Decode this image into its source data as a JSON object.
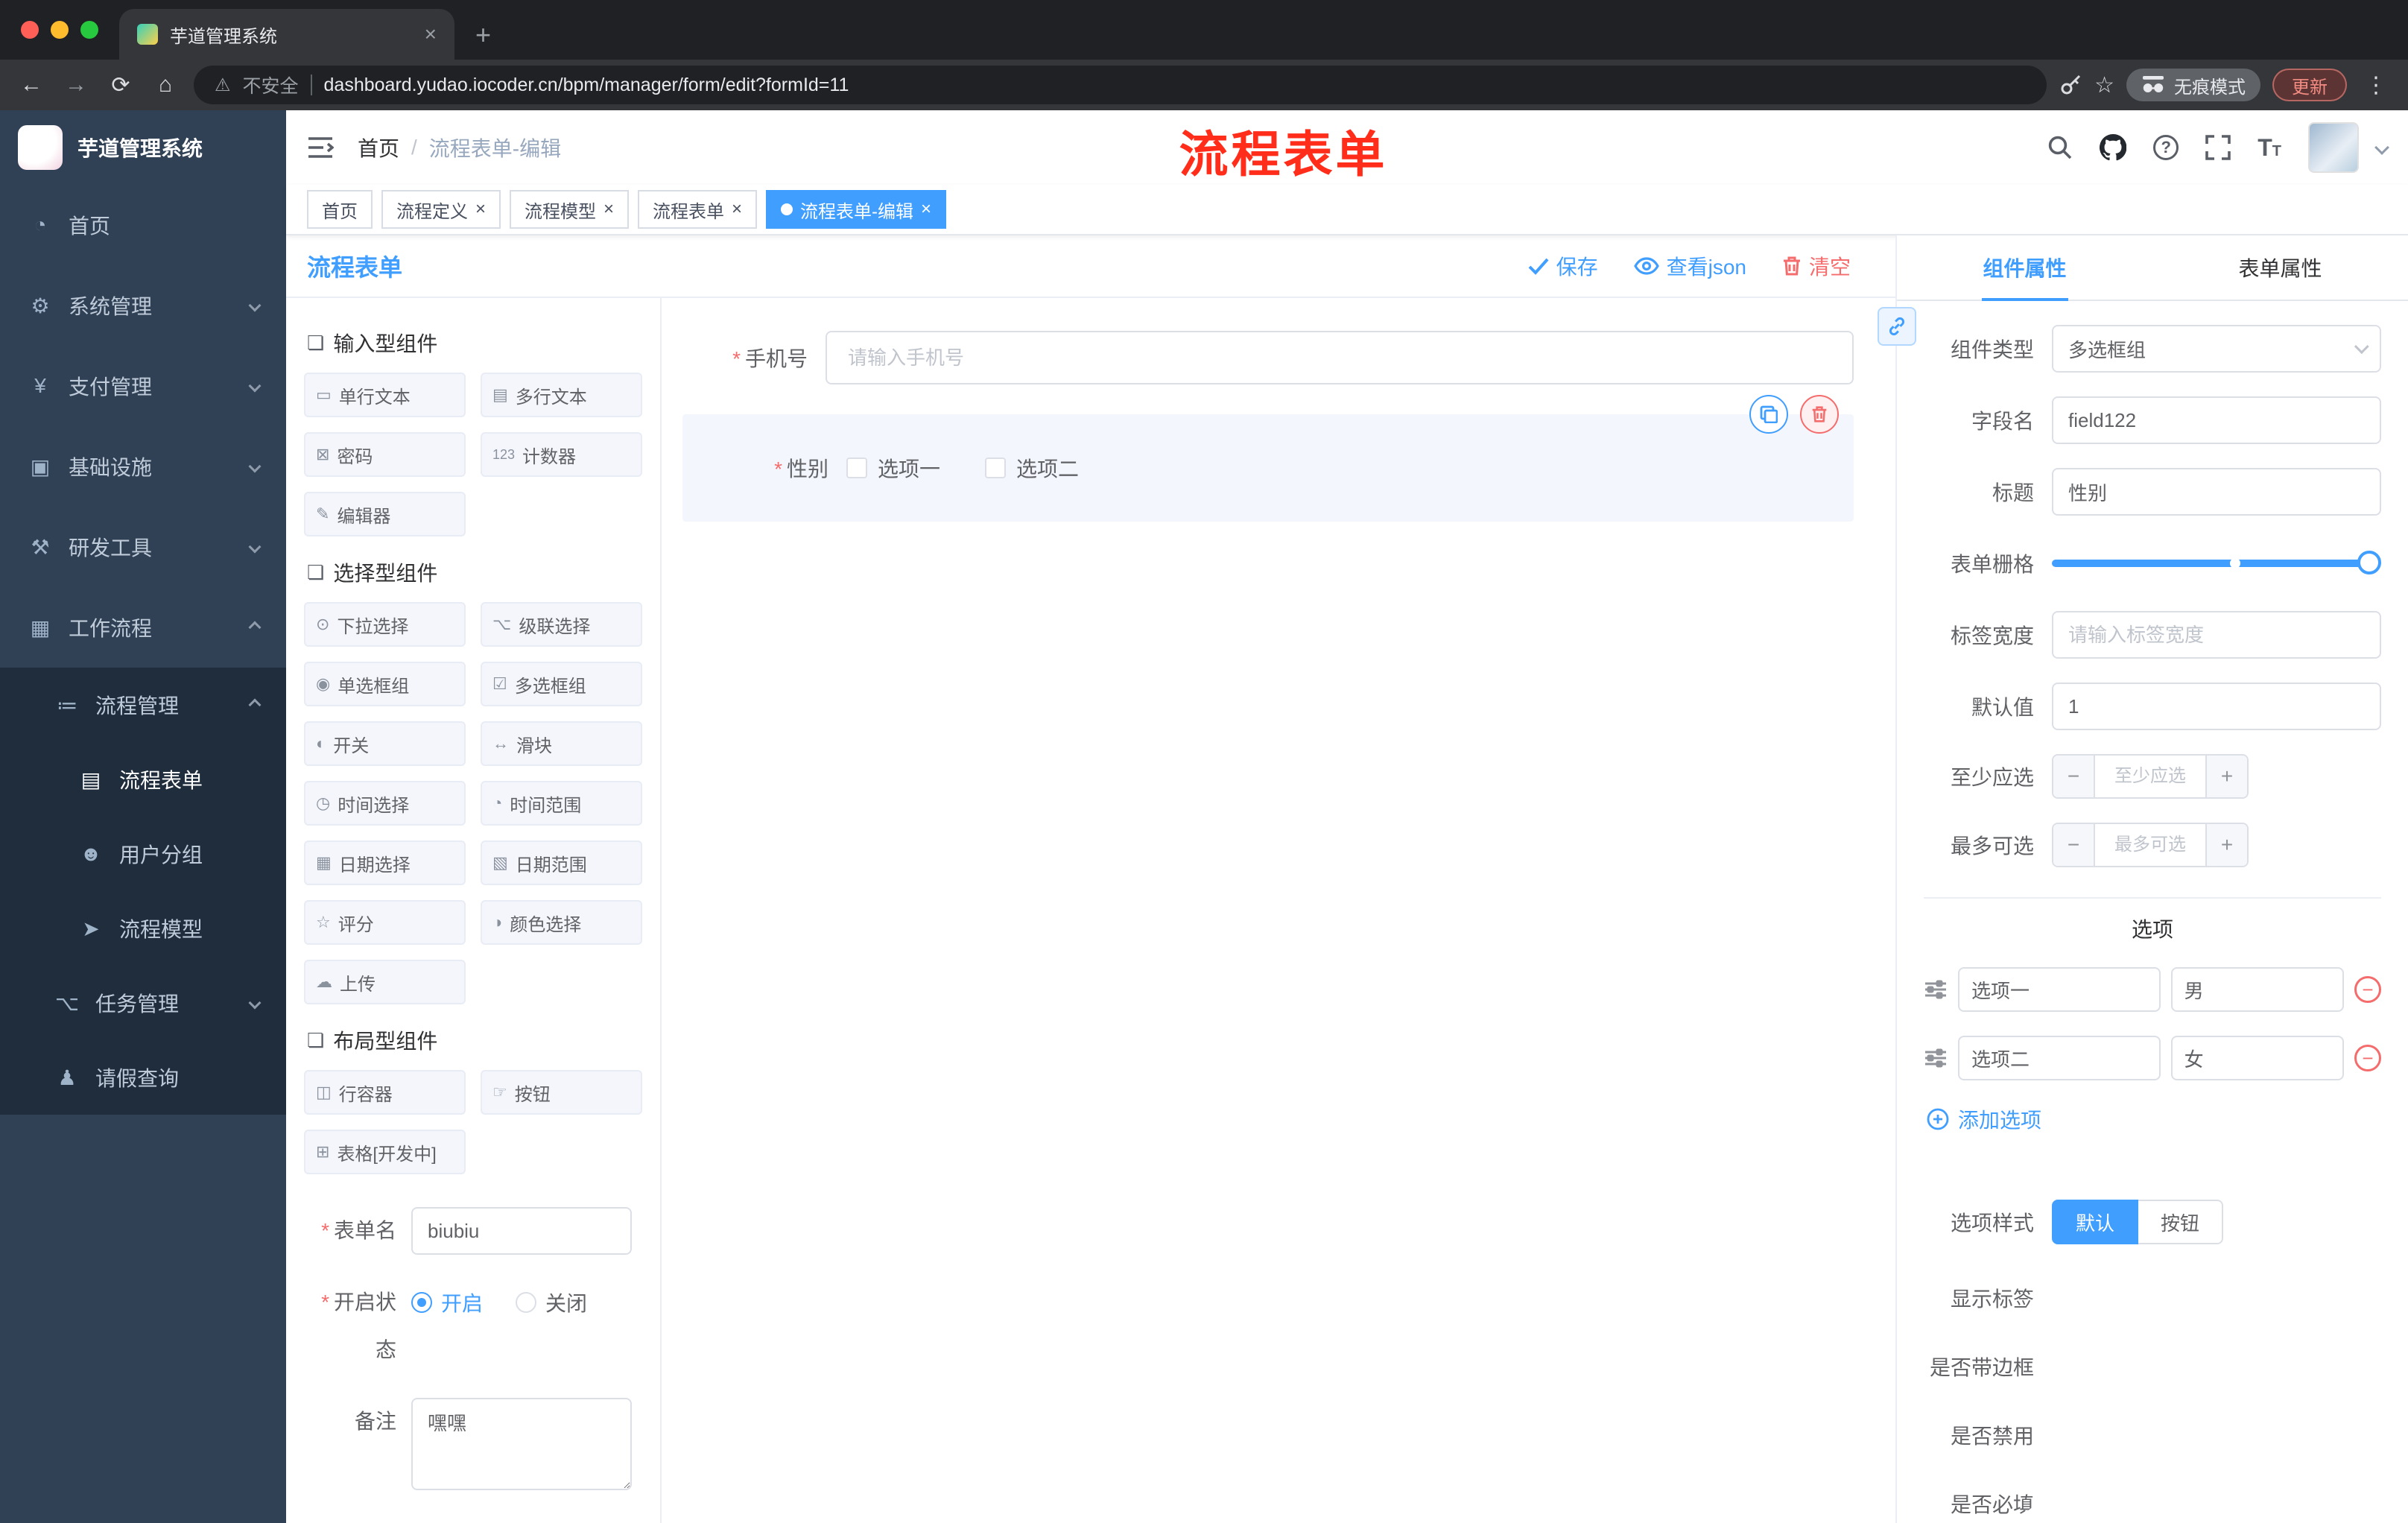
{
  "browser": {
    "tab_title": "芋道管理系统",
    "security_label": "不安全",
    "url": "dashboard.yudao.iocoder.cn/bpm/manager/form/edit?formId=11",
    "incognito_label": "无痕模式",
    "update_label": "更新"
  },
  "annotation": "流程表单",
  "sidebar": {
    "title": "芋道管理系统",
    "items": [
      {
        "icon": "◔",
        "label": "首页"
      },
      {
        "icon": "⚙",
        "label": "系统管理"
      },
      {
        "icon": "¥",
        "label": "支付管理"
      },
      {
        "icon": "▣",
        "label": "基础设施"
      },
      {
        "icon": "⚒",
        "label": "研发工具"
      },
      {
        "icon": "▦",
        "label": "工作流程"
      }
    ],
    "submenu": {
      "icon": "≔",
      "label": "流程管理",
      "children": [
        {
          "icon": "▤",
          "label": "流程表单"
        },
        {
          "icon": "☻",
          "label": "用户分组"
        },
        {
          "icon": "➤",
          "label": "流程模型"
        }
      ]
    },
    "task": {
      "icon": "⌥",
      "label": "任务管理"
    },
    "leave": {
      "icon": "♟",
      "label": "请假查询"
    }
  },
  "header": {
    "breadcrumb_home": "首页",
    "breadcrumb_current": "流程表单-编辑"
  },
  "tags": [
    {
      "label": "首页"
    },
    {
      "label": "流程定义"
    },
    {
      "label": "流程模型"
    },
    {
      "label": "流程表单"
    },
    {
      "label": "流程表单-编辑"
    }
  ],
  "editor": {
    "title": "流程表单",
    "save_label": "保存",
    "view_json_label": "查看json",
    "clear_label": "清空",
    "groups": [
      {
        "icon": "❏",
        "title": "输入型组件",
        "items": [
          {
            "icon": "▭",
            "label": "单行文本"
          },
          {
            "icon": "▤",
            "label": "多行文本"
          },
          {
            "icon": "⊠",
            "label": "密码"
          },
          {
            "icon": "123",
            "label": "计数器"
          },
          {
            "icon": "✎",
            "label": "编辑器"
          }
        ]
      },
      {
        "icon": "❏",
        "title": "选择型组件",
        "items": [
          {
            "icon": "⊙",
            "label": "下拉选择"
          },
          {
            "icon": "⌥",
            "label": "级联选择"
          },
          {
            "icon": "◉",
            "label": "单选框组"
          },
          {
            "icon": "☑",
            "label": "多选框组"
          },
          {
            "icon": "◐",
            "label": "开关"
          },
          {
            "icon": "↔",
            "label": "滑块"
          },
          {
            "icon": "◷",
            "label": "时间选择"
          },
          {
            "icon": "◔",
            "label": "时间范围"
          },
          {
            "icon": "▦",
            "label": "日期选择"
          },
          {
            "icon": "▧",
            "label": "日期范围"
          },
          {
            "icon": "☆",
            "label": "评分"
          },
          {
            "icon": "◑",
            "label": "颜色选择"
          },
          {
            "icon": "☁",
            "label": "上传"
          }
        ]
      },
      {
        "icon": "❏",
        "title": "布局型组件",
        "items": [
          {
            "icon": "◫",
            "label": "行容器"
          },
          {
            "icon": "☞",
            "label": "按钮"
          },
          {
            "icon": "⊞",
            "label": "表格[开发中]"
          }
        ]
      }
    ],
    "form_settings": {
      "name_label": "表单名",
      "name_value": "biubiu",
      "status_label": "开启状态",
      "status_on": "开启",
      "status_off": "关闭",
      "remark_label": "备注",
      "remark_value": "嘿嘿"
    },
    "canvas": {
      "phone_label": "手机号",
      "phone_placeholder": "请输入手机号",
      "gender_label": "性别",
      "gender_option1": "选项一",
      "gender_option2": "选项二"
    }
  },
  "props": {
    "tab_component": "组件属性",
    "tab_form": "表单属性",
    "type_label": "组件类型",
    "type_value": "多选框组",
    "field_label": "字段名",
    "field_value": "field122",
    "title_label": "标题",
    "title_value": "性别",
    "grid_label": "表单栅格",
    "width_label": "标签宽度",
    "width_placeholder": "请输入标签宽度",
    "default_label": "默认值",
    "default_value": "1",
    "min_label": "至少应选",
    "min_placeholder": "至少应选",
    "max_label": "最多可选",
    "max_placeholder": "最多可选",
    "options_title": "选项",
    "options": [
      {
        "label": "选项一",
        "value": "男"
      },
      {
        "label": "选项二",
        "value": "女"
      }
    ],
    "add_option_label": "添加选项",
    "style_label": "选项样式",
    "style_default": "默认",
    "style_button": "按钮",
    "switch_show": {
      "label": "显示标签",
      "state": "on"
    },
    "switch_border": {
      "label": "是否带边框",
      "state": "off"
    },
    "switch_disabled": {
      "label": "是否禁用",
      "state": "off"
    },
    "switch_required": {
      "label": "是否必填",
      "state": "on"
    }
  }
}
